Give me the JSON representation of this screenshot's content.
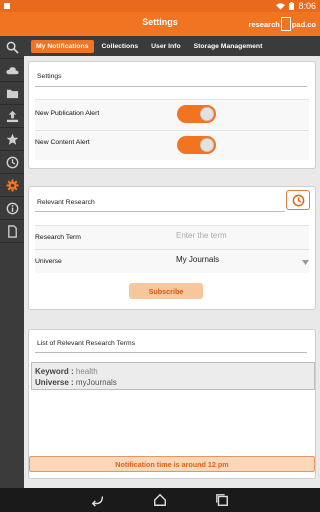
{
  "status": {
    "time": "8:06"
  },
  "appbar": {
    "title": "Settings",
    "logo_left": "research",
    "logo_right": "pad.co"
  },
  "sidebar": [
    {
      "icon": "search-icon"
    },
    {
      "icon": "cloud-icon"
    },
    {
      "icon": "folder-icon"
    },
    {
      "icon": "upload-icon"
    },
    {
      "icon": "star-icon"
    },
    {
      "icon": "clock-icon"
    },
    {
      "icon": "gear-icon"
    },
    {
      "icon": "info-icon"
    },
    {
      "icon": "document-icon"
    }
  ],
  "tabs": [
    {
      "label": "My Notifications",
      "active": true
    },
    {
      "label": "Collections",
      "active": false
    },
    {
      "label": "User Info",
      "active": false
    },
    {
      "label": "Storage Management",
      "active": false
    }
  ],
  "settings": {
    "heading": "Settings",
    "new_publication_alert": "New Publication Alert",
    "new_content_alert": "New Content Alert",
    "publication_on": true,
    "content_on": true
  },
  "research": {
    "heading": "Relevant Research",
    "term_label": "Research Term",
    "term_placeholder": "Enter the term",
    "universe_label": "Universe",
    "universe_value": "My Journals",
    "subscribe_label": "Subscribe"
  },
  "terms_list": {
    "heading": "List of Relevant Research Terms",
    "keyword_label": "Keyword : ",
    "keyword_value": "health",
    "universe_label": "Universe : ",
    "universe_value": "myJournals"
  },
  "notification": "Notification time is around 12 pm",
  "colors": {
    "accent": "#f07422",
    "dark": "#3b3b3b"
  }
}
